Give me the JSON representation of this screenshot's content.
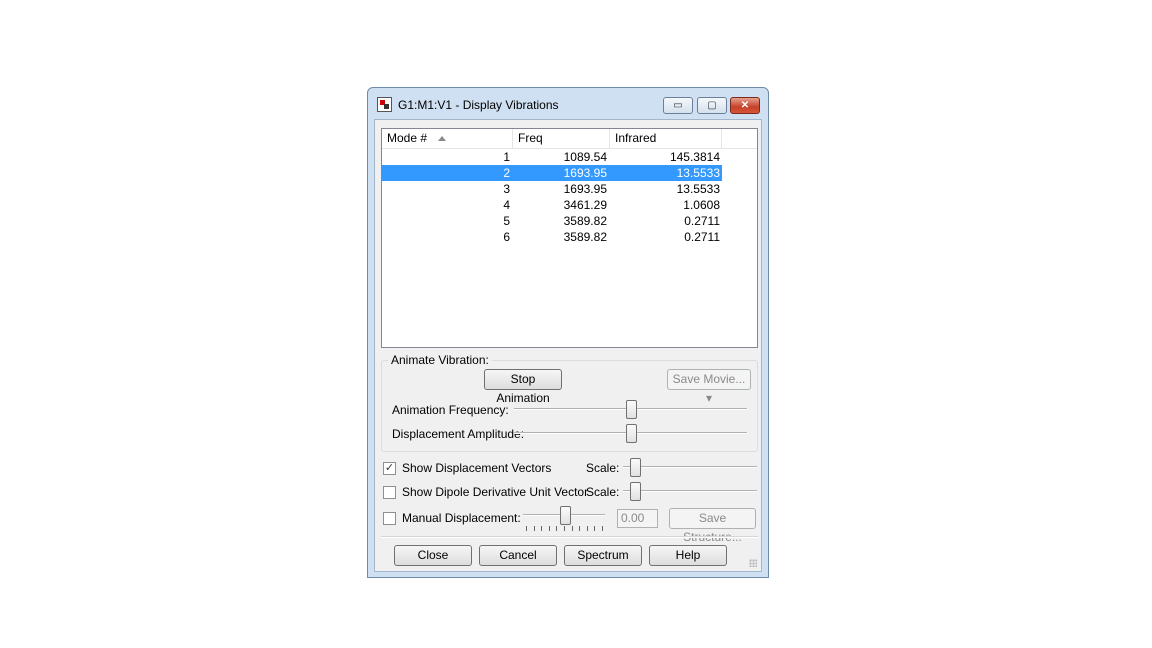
{
  "window": {
    "title": "G1:M1:V1 - Display Vibrations",
    "caption_buttons": {
      "minimize": "▭",
      "maximize": "▢",
      "close": "✕"
    }
  },
  "table": {
    "headers": [
      "Mode #",
      "Freq",
      "Infrared"
    ],
    "sorted_column": "Mode #",
    "selected_row": 2,
    "rows": [
      {
        "mode": "1",
        "freq": "1089.54",
        "infrared": "145.3814"
      },
      {
        "mode": "2",
        "freq": "1693.95",
        "infrared": "13.5533"
      },
      {
        "mode": "3",
        "freq": "1693.95",
        "infrared": "13.5533"
      },
      {
        "mode": "4",
        "freq": "3461.29",
        "infrared": "1.0608"
      },
      {
        "mode": "5",
        "freq": "3589.82",
        "infrared": "0.2711"
      },
      {
        "mode": "6",
        "freq": "3589.82",
        "infrared": "0.2711"
      }
    ]
  },
  "animate": {
    "group_label": "Animate Vibration:",
    "stop_button": "Stop Animation",
    "save_movie_button": "Save Movie...",
    "frequency_label": "Animation Frequency:",
    "amplitude_label": "Displacement Amplitude:",
    "frequency_level": 0.5,
    "amplitude_level": 0.5
  },
  "options": {
    "show_displacement_vectors": {
      "label": "Show Displacement Vectors",
      "checked": true,
      "check_glyph": "✓",
      "scale_label": "Scale:",
      "scale_level": 0.05
    },
    "show_dipole": {
      "label": "Show Dipole Derivative Unit Vector",
      "checked": false,
      "scale_label": "Scale:",
      "scale_level": 0.05
    },
    "manual_displacement": {
      "label": "Manual Displacement:",
      "checked": false,
      "value": "0.00",
      "level": 0.5,
      "save_structure_button": "Save Structure..."
    }
  },
  "buttons": {
    "close": "Close",
    "cancel": "Cancel",
    "spectrum": "Spectrum",
    "help": "Help"
  },
  "colors": {
    "selection": "#3399ff",
    "frame": "#cfe0f2",
    "close_button": "#c4422a"
  }
}
